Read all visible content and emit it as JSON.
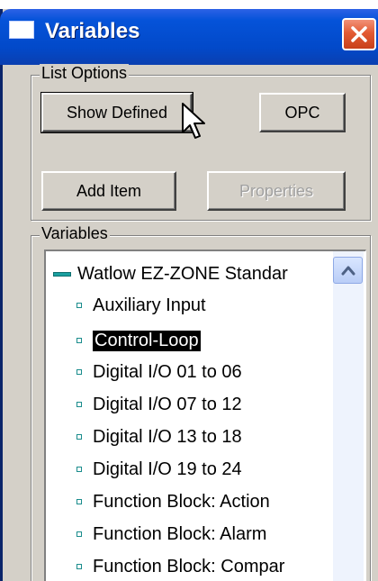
{
  "window": {
    "title": "Variables",
    "close_icon": "close-icon",
    "colors": {
      "titlebar": "#0553d9",
      "body": "#d4d0c8",
      "close": "#e35b34"
    }
  },
  "list_options": {
    "label": "List Options",
    "show_defined_label": "Show Defined",
    "opc_label": "OPC",
    "add_item_label": "Add Item",
    "properties_label": "Properties"
  },
  "variables": {
    "label": "Variables",
    "root": "Watlow EZ-ZONE Standar",
    "items": [
      "Auxiliary Input",
      "Control-Loop",
      "Digital I/O 01 to 06",
      "Digital I/O 07 to 12",
      "Digital I/O 13 to 18",
      "Digital I/O 19 to 24",
      "Function Block: Action",
      "Function Block: Alarm",
      "Function Block: Compar"
    ],
    "selected_item": "Control-Loop"
  },
  "cursor": {
    "icon": "mouse-pointer-icon"
  }
}
